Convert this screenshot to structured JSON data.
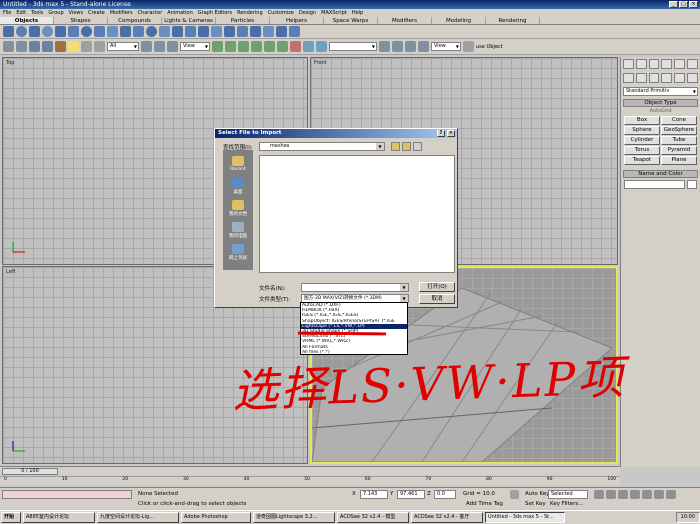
{
  "window": {
    "title": "Untitled - 3ds max 5 - Stand-alone License"
  },
  "menu": [
    "File",
    "Edit",
    "Tools",
    "Group",
    "Views",
    "Create",
    "Modifiers",
    "Character",
    "Animation",
    "Graph Editors",
    "Rendering",
    "Customize",
    "Design",
    "MAXScript",
    "Help"
  ],
  "tabs": [
    "Objects",
    "Shapes",
    "Compounds",
    "Lights & Cameras",
    "Particles",
    "Helpers",
    "Space Warps",
    "Modifiers",
    "Modeling",
    "Rendering"
  ],
  "toolbar": {
    "filter_value": "All",
    "view1": "View",
    "view2": "View",
    "use_object": "use Object"
  },
  "viewports": {
    "top": "Top",
    "front": "Front",
    "left": "Left"
  },
  "command_panel": {
    "category": "Standard Primitiv",
    "object_type_header": "Object Type",
    "autogrid": "AutoGrid",
    "buttons": [
      "Box",
      "Cone",
      "Sphere",
      "GeoSphere",
      "Cylinder",
      "Tube",
      "Torus",
      "Pyramid",
      "Teapot",
      "Plane"
    ],
    "name_color_header": "Name and Color"
  },
  "dialog": {
    "title": "Select File to Import",
    "look_in_label": "查找范围(I):",
    "look_in_value": "meshes",
    "places": [
      "Recent",
      "桌面",
      "我的文档",
      "我的电脑",
      "网上邻居"
    ],
    "filename_label": "文件名(N):",
    "filetype_label": "文件类型(T):",
    "filetype_value": "图方-3D MAX(VIZ)转换文件 (*.3DM)",
    "open_button": "打开(O)",
    "cancel_button": "取消",
    "types": [
      "AutoCAD (*.DXF)",
      "FiLMBOX (*.FBX)",
      "IGES (*.IGE,*.IGS,*.IGES)",
      "ShapObject: IGES/Rhino/STEP/SAT (*.IGE",
      "Lightscape (*.LS,*.VW,*.LP)",
      "3D Studio Shape (*.SHP)",
      "StereoLitho (*.STL)",
      "VRML (*.WRL,*.WRZ)",
      "All Formats",
      "All files (*.*)"
    ],
    "selected_type_index": 4
  },
  "annotation": "选择LS·VW·LP项",
  "timeline": {
    "slider": "0 / 100",
    "ticks": [
      "0",
      "10",
      "20",
      "30",
      "40",
      "50",
      "60",
      "70",
      "80",
      "90",
      "100"
    ]
  },
  "status": {
    "selection": "None Selected",
    "prompt": "Click or click-and-drag to select objects",
    "x": "7.143",
    "y": "97.461",
    "z": "0.0",
    "grid": "Grid = 10.0",
    "add_time_tag": "Add Time Tag",
    "auto_key": "Auto Key",
    "set_key": "Set Key",
    "selected": "Selected",
    "key_filters": "Key Filters..."
  },
  "taskbar": {
    "start": "开始",
    "items": [
      "A885室内设计论坛",
      "九度空间设计论坛-Lig...",
      "Adobe Photoshop",
      "道奇因图Lightscape 3.2...",
      "ACDSee 32 v2.4 - 模型",
      "ACDSee 32 v2.4 - 客厅",
      "Untitled - 3ds max 5 - St..."
    ],
    "active_index": 6,
    "clock": "10:00"
  },
  "colors": {
    "accent": "#0a246a",
    "annotation": "#e00000",
    "viewport_highlight": "#e6e65a"
  }
}
